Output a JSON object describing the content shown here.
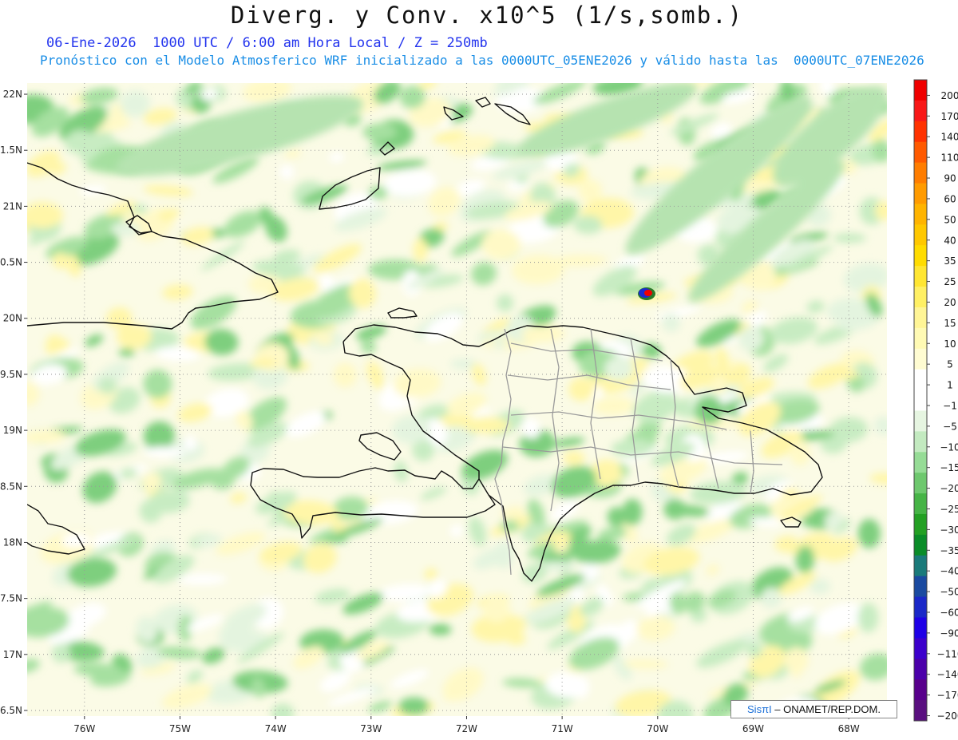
{
  "title": "Diverg. y Conv. x10^5 (1/s,somb.)",
  "subtitle_line1": "06-Ene-2026  1000 UTC / 6:00 am Hora Local / Z = 250mb",
  "subtitle_line2": "Pronóstico con el Modelo Atmosferico WRF inicializado a las 0000UTC_05ENE2026 y válido hasta las  0000UTC_07ENE2026",
  "credit": {
    "logo": "SisπI",
    "text": "– ONAMET/REP.DOM."
  },
  "map": {
    "lon_range": [
      -76.6,
      -67.6
    ],
    "lat_range": [
      16.45,
      22.1
    ],
    "lat_labels": [
      "22N",
      "1.5N",
      "21N",
      "0.5N",
      "20N",
      "9.5N",
      "19N",
      "8.5N",
      "18N",
      "7.5N",
      "17N",
      "6.5N"
    ],
    "lat_values": [
      22,
      21.5,
      21,
      20.5,
      20,
      19.5,
      19,
      18.5,
      18,
      17.5,
      17,
      16.5
    ],
    "lon_labels": [
      "76W",
      "75W",
      "74W",
      "73W",
      "72W",
      "71W",
      "70W",
      "69W",
      "68W"
    ],
    "lon_values": [
      -76,
      -75,
      -74,
      -73,
      -72,
      -71,
      -70,
      -69,
      -68
    ],
    "grid": "dotted",
    "region": "Hispaniola (Haiti and Dominican Republic)",
    "features": [
      "coastlines",
      "province borders"
    ]
  },
  "legend": {
    "labels": [
      "200",
      "170",
      "140",
      "110",
      "90",
      "60",
      "50",
      "40",
      "35",
      "25",
      "20",
      "15",
      "10",
      "5",
      "1",
      "−1",
      "−5",
      "−10",
      "−15",
      "−20",
      "−25",
      "−30",
      "−35",
      "−40",
      "−50",
      "−60",
      "−90",
      "−110",
      "−140",
      "−170",
      "−200"
    ],
    "colors": [
      "#f00000",
      "#f81818",
      "#ff3200",
      "#ff5a00",
      "#ff7d00",
      "#ff9b00",
      "#ffb400",
      "#ffc800",
      "#ffdc00",
      "#ffe632",
      "#fff064",
      "#fff596",
      "#fffab4",
      "#fffcd2",
      "#ffffff",
      "#ffffff",
      "#e6f5e1",
      "#c3eac0",
      "#96dc96",
      "#6ec86e",
      "#46b446",
      "#23a023",
      "#0a8c28",
      "#1a7a7a",
      "#1a4aa0",
      "#1a28c8",
      "#1e00e6",
      "#3c00cc",
      "#4b00aa",
      "#58008c",
      "#5a1080"
    ]
  }
}
